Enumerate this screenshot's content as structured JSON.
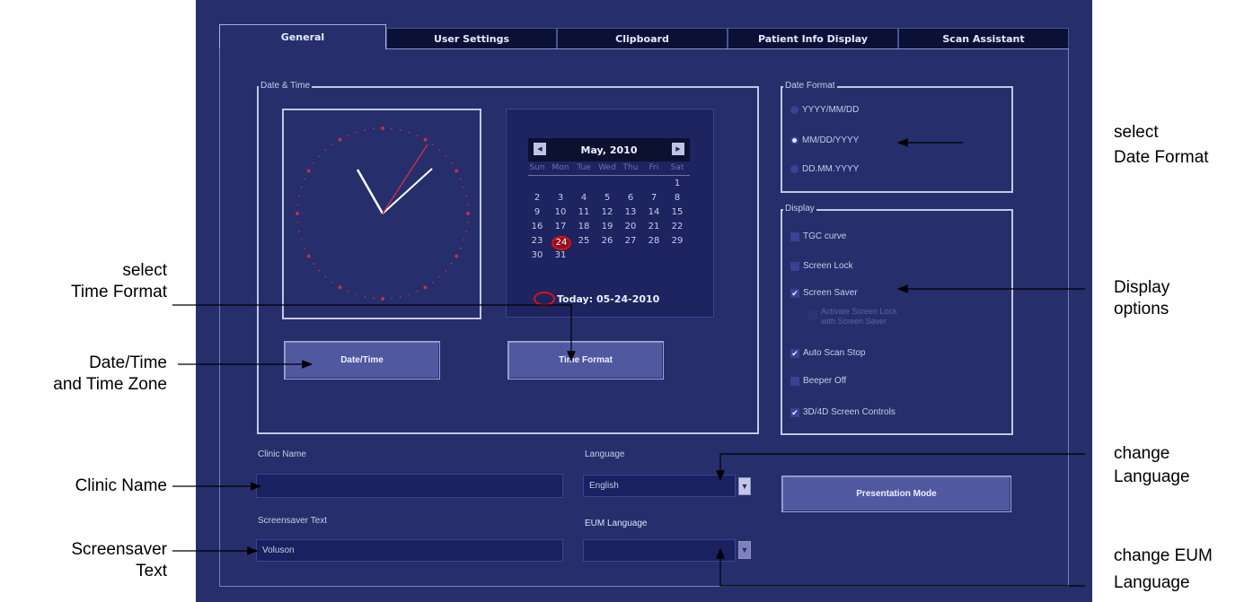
{
  "tabs": [
    {
      "label": "General",
      "active": true
    },
    {
      "label": "User Settings",
      "active": false
    },
    {
      "label": "Clipboard",
      "active": false
    },
    {
      "label": "Patient Info Display",
      "active": false
    },
    {
      "label": "Scan Assistant",
      "active": false
    }
  ],
  "date_time_group": {
    "label": "Date & Time",
    "date_time_button": "Date/Time",
    "time_format_button": "Time Format"
  },
  "calendar": {
    "month_label": "May, 2010",
    "weekdays": [
      "Sun",
      "Mon",
      "Tue",
      "Wed",
      "Thu",
      "Fri",
      "Sat"
    ],
    "rows": [
      [
        "",
        "",
        "",
        "",
        "",
        "",
        "1"
      ],
      [
        "2",
        "3",
        "4",
        "5",
        "6",
        "7",
        "8"
      ],
      [
        "9",
        "10",
        "11",
        "12",
        "13",
        "14",
        "15"
      ],
      [
        "16",
        "17",
        "18",
        "19",
        "20",
        "21",
        "22"
      ],
      [
        "23",
        "24",
        "25",
        "26",
        "27",
        "28",
        "29"
      ],
      [
        "30",
        "31",
        "",
        "",
        "",
        "",
        ""
      ]
    ],
    "selected_day": "24",
    "today_label": "Today: 05-24-2010"
  },
  "date_format": {
    "label": "Date Format",
    "options": [
      "YYYY/MM/DD",
      "MM/DD/YYYY",
      "DD.MM.YYYY"
    ],
    "selected": "MM/DD/YYYY"
  },
  "display": {
    "label": "Display",
    "tgc_curve": "TGC curve",
    "screen_lock": "Screen Lock",
    "screen_saver": "Screen Saver",
    "activate_screen_lock": "Activate Screen Lock with Screen Saver",
    "auto_scan_stop": "Auto Scan Stop",
    "beeper_off": "Beeper Off",
    "screen_controls": "3D/4D Screen Controls",
    "checked": {
      "tgc_curve": false,
      "screen_lock": false,
      "screen_saver": true,
      "activate_screen_lock": false,
      "auto_scan_stop": true,
      "beeper_off": false,
      "screen_controls": true
    }
  },
  "fields": {
    "clinic_name_label": "Clinic Name",
    "clinic_name_value": "",
    "screensaver_text_label": "Screensaver Text",
    "screensaver_text_value": "Voluson",
    "language_label": "Language",
    "language_value": "English",
    "eum_language_label": "EUM Language",
    "eum_language_value": "",
    "presentation_mode_button": "Presentation Mode"
  },
  "annotations": {
    "select_time_format": [
      "select",
      "Time Format"
    ],
    "date_time_zone": [
      "Date/Time",
      "and Time Zone"
    ],
    "clinic_name": "Clinic Name",
    "screensaver_text": [
      "Screensaver",
      "Text"
    ],
    "select_date_format": [
      "select",
      "Date Format"
    ],
    "display_options": [
      "Display",
      "options"
    ],
    "change_language": [
      "change",
      "Language"
    ],
    "change_eum_language": [
      "change EUM",
      "Language"
    ]
  },
  "colors": {
    "panel_bg": "#262e6c",
    "clock_marks": "#c0304a",
    "clock_hands": "#ffffff",
    "second_hand": "#c0304a",
    "today_circle": "#e01010"
  }
}
